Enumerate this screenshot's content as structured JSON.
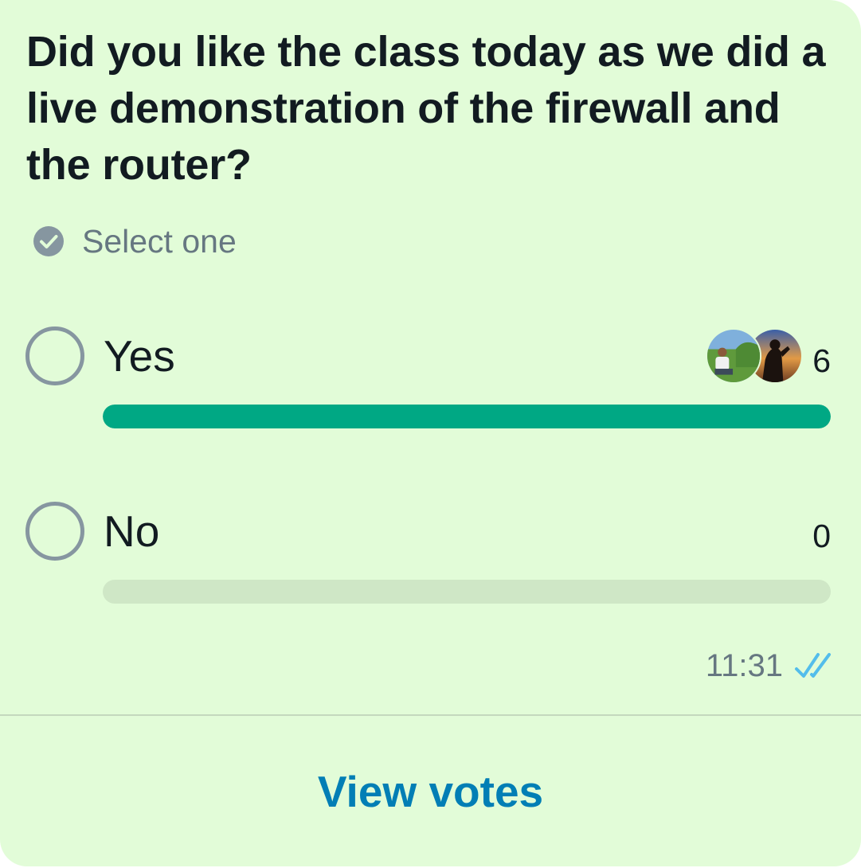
{
  "poll": {
    "question": "Did you like the class today as we did a live demonstration of the firewall and the router?",
    "select_hint": "Select one",
    "options": [
      {
        "label": "Yes",
        "votes": "6",
        "share": 1.0
      },
      {
        "label": "No",
        "votes": "0",
        "share": 0.0
      }
    ]
  },
  "message": {
    "time": "11:31",
    "status_icon": "double-check-read-icon"
  },
  "actions": {
    "view_votes_label": "View votes"
  },
  "colors": {
    "bubble_background": "#e2fcd8",
    "bar_fill": "#00a884",
    "bar_track": "#cfe7c6",
    "link": "#027eb5",
    "read_ticks": "#53bdeb",
    "secondary_text": "#667781"
  }
}
